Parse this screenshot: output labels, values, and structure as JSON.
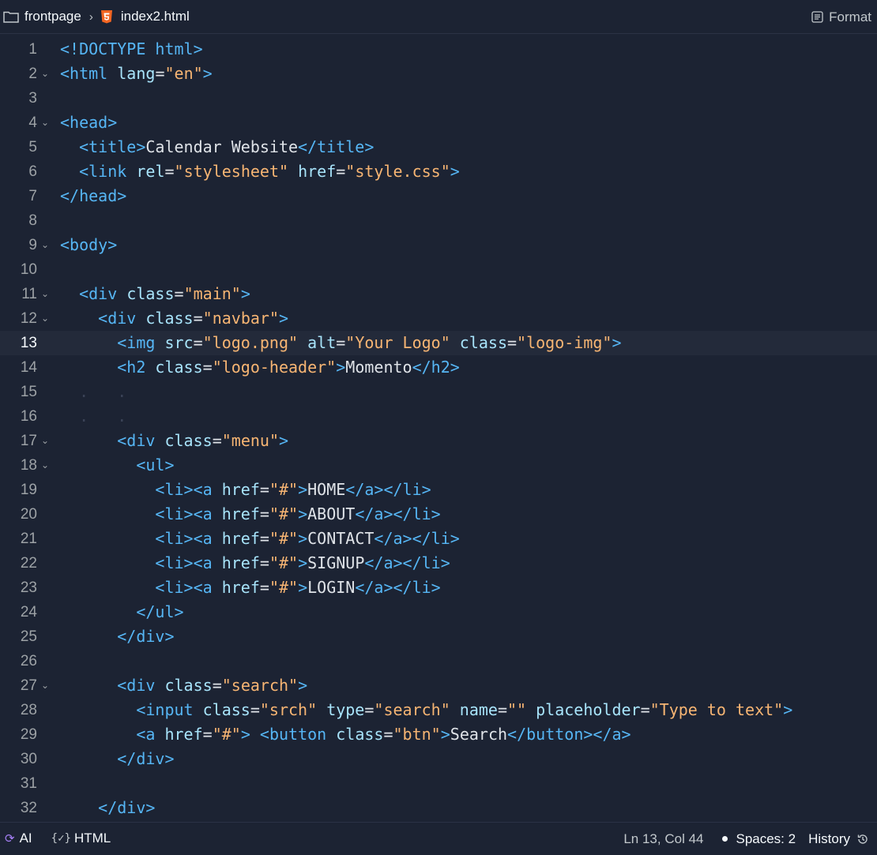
{
  "breadcrumb": {
    "folder": "frontpage",
    "file": "index2.html"
  },
  "toolbar": {
    "format_label": "Format"
  },
  "editor": {
    "active_line": 13,
    "lines": [
      {
        "n": "1",
        "fold": false,
        "code": [
          {
            "c": "t",
            "v": "<!DOCTYPE html>"
          }
        ]
      },
      {
        "n": "2",
        "fold": true,
        "code": [
          {
            "c": "t",
            "v": "<html"
          },
          {
            "c": "p",
            "v": " "
          },
          {
            "c": "a",
            "v": "lang"
          },
          {
            "c": "p",
            "v": "="
          },
          {
            "c": "s",
            "v": "\"en\""
          },
          {
            "c": "t",
            "v": ">"
          }
        ]
      },
      {
        "n": "3",
        "fold": false,
        "code": []
      },
      {
        "n": "4",
        "fold": true,
        "code": [
          {
            "c": "t",
            "v": "<head>"
          }
        ]
      },
      {
        "n": "5",
        "fold": false,
        "code": [
          {
            "c": "p",
            "v": "  "
          },
          {
            "c": "t",
            "v": "<title>"
          },
          {
            "c": "p",
            "v": "Calendar Website"
          },
          {
            "c": "t",
            "v": "</title>"
          }
        ]
      },
      {
        "n": "6",
        "fold": false,
        "code": [
          {
            "c": "p",
            "v": "  "
          },
          {
            "c": "t",
            "v": "<link"
          },
          {
            "c": "p",
            "v": " "
          },
          {
            "c": "a",
            "v": "rel"
          },
          {
            "c": "p",
            "v": "="
          },
          {
            "c": "s",
            "v": "\"stylesheet\""
          },
          {
            "c": "p",
            "v": " "
          },
          {
            "c": "a",
            "v": "href"
          },
          {
            "c": "p",
            "v": "="
          },
          {
            "c": "s",
            "v": "\"style.css\""
          },
          {
            "c": "t",
            "v": ">"
          }
        ]
      },
      {
        "n": "7",
        "fold": false,
        "code": [
          {
            "c": "t",
            "v": "</head>"
          }
        ]
      },
      {
        "n": "8",
        "fold": false,
        "code": []
      },
      {
        "n": "9",
        "fold": true,
        "code": [
          {
            "c": "t",
            "v": "<body>"
          }
        ]
      },
      {
        "n": "10",
        "fold": false,
        "code": []
      },
      {
        "n": "11",
        "fold": true,
        "code": [
          {
            "c": "p",
            "v": "  "
          },
          {
            "c": "t",
            "v": "<div"
          },
          {
            "c": "p",
            "v": " "
          },
          {
            "c": "a",
            "v": "class"
          },
          {
            "c": "p",
            "v": "="
          },
          {
            "c": "s",
            "v": "\"main\""
          },
          {
            "c": "t",
            "v": ">"
          }
        ]
      },
      {
        "n": "12",
        "fold": true,
        "code": [
          {
            "c": "p",
            "v": "    "
          },
          {
            "c": "t",
            "v": "<div"
          },
          {
            "c": "p",
            "v": " "
          },
          {
            "c": "a",
            "v": "class"
          },
          {
            "c": "p",
            "v": "="
          },
          {
            "c": "s",
            "v": "\"navbar\""
          },
          {
            "c": "t",
            "v": ">"
          }
        ]
      },
      {
        "n": "13",
        "fold": false,
        "code": [
          {
            "c": "p",
            "v": "      "
          },
          {
            "c": "t",
            "v": "<img"
          },
          {
            "c": "p",
            "v": " "
          },
          {
            "c": "a",
            "v": "src"
          },
          {
            "c": "p",
            "v": "="
          },
          {
            "c": "s",
            "v": "\"logo.png\""
          },
          {
            "c": "p",
            "v": " "
          },
          {
            "c": "a",
            "v": "alt"
          },
          {
            "c": "p",
            "v": "="
          },
          {
            "c": "s",
            "v": "\"Your Logo\""
          },
          {
            "c": "p",
            "v": " "
          },
          {
            "c": "a",
            "v": "class"
          },
          {
            "c": "p",
            "v": "="
          },
          {
            "c": "s",
            "v": "\"logo-img\""
          },
          {
            "c": "t",
            "v": ">"
          }
        ]
      },
      {
        "n": "14",
        "fold": false,
        "code": [
          {
            "c": "p",
            "v": "      "
          },
          {
            "c": "t",
            "v": "<h2"
          },
          {
            "c": "p",
            "v": " "
          },
          {
            "c": "a",
            "v": "class"
          },
          {
            "c": "p",
            "v": "="
          },
          {
            "c": "s",
            "v": "\"logo-header\""
          },
          {
            "c": "t",
            "v": ">"
          },
          {
            "c": "p",
            "v": "Momento"
          },
          {
            "c": "t",
            "v": "</h2>"
          }
        ]
      },
      {
        "n": "15",
        "fold": false,
        "code": [
          {
            "c": "g",
            "v": "  .   ."
          }
        ]
      },
      {
        "n": "16",
        "fold": false,
        "code": [
          {
            "c": "g",
            "v": "  .   ."
          }
        ]
      },
      {
        "n": "17",
        "fold": true,
        "code": [
          {
            "c": "p",
            "v": "      "
          },
          {
            "c": "t",
            "v": "<div"
          },
          {
            "c": "p",
            "v": " "
          },
          {
            "c": "a",
            "v": "class"
          },
          {
            "c": "p",
            "v": "="
          },
          {
            "c": "s",
            "v": "\"menu\""
          },
          {
            "c": "t",
            "v": ">"
          }
        ]
      },
      {
        "n": "18",
        "fold": true,
        "code": [
          {
            "c": "p",
            "v": "        "
          },
          {
            "c": "t",
            "v": "<ul>"
          }
        ]
      },
      {
        "n": "19",
        "fold": false,
        "code": [
          {
            "c": "p",
            "v": "          "
          },
          {
            "c": "t",
            "v": "<li><a"
          },
          {
            "c": "p",
            "v": " "
          },
          {
            "c": "a",
            "v": "href"
          },
          {
            "c": "p",
            "v": "="
          },
          {
            "c": "s",
            "v": "\"#\""
          },
          {
            "c": "t",
            "v": ">"
          },
          {
            "c": "p",
            "v": "HOME"
          },
          {
            "c": "t",
            "v": "</a></li>"
          }
        ]
      },
      {
        "n": "20",
        "fold": false,
        "code": [
          {
            "c": "p",
            "v": "          "
          },
          {
            "c": "t",
            "v": "<li><a"
          },
          {
            "c": "p",
            "v": " "
          },
          {
            "c": "a",
            "v": "href"
          },
          {
            "c": "p",
            "v": "="
          },
          {
            "c": "s",
            "v": "\"#\""
          },
          {
            "c": "t",
            "v": ">"
          },
          {
            "c": "p",
            "v": "ABOUT"
          },
          {
            "c": "t",
            "v": "</a></li>"
          }
        ]
      },
      {
        "n": "21",
        "fold": false,
        "code": [
          {
            "c": "p",
            "v": "          "
          },
          {
            "c": "t",
            "v": "<li><a"
          },
          {
            "c": "p",
            "v": " "
          },
          {
            "c": "a",
            "v": "href"
          },
          {
            "c": "p",
            "v": "="
          },
          {
            "c": "s",
            "v": "\"#\""
          },
          {
            "c": "t",
            "v": ">"
          },
          {
            "c": "p",
            "v": "CONTACT"
          },
          {
            "c": "t",
            "v": "</a></li>"
          }
        ]
      },
      {
        "n": "22",
        "fold": false,
        "code": [
          {
            "c": "p",
            "v": "          "
          },
          {
            "c": "t",
            "v": "<li><a"
          },
          {
            "c": "p",
            "v": " "
          },
          {
            "c": "a",
            "v": "href"
          },
          {
            "c": "p",
            "v": "="
          },
          {
            "c": "s",
            "v": "\"#\""
          },
          {
            "c": "t",
            "v": ">"
          },
          {
            "c": "p",
            "v": "SIGNUP"
          },
          {
            "c": "t",
            "v": "</a></li>"
          }
        ]
      },
      {
        "n": "23",
        "fold": false,
        "code": [
          {
            "c": "p",
            "v": "          "
          },
          {
            "c": "t",
            "v": "<li><a"
          },
          {
            "c": "p",
            "v": " "
          },
          {
            "c": "a",
            "v": "href"
          },
          {
            "c": "p",
            "v": "="
          },
          {
            "c": "s",
            "v": "\"#\""
          },
          {
            "c": "t",
            "v": ">"
          },
          {
            "c": "p",
            "v": "LOGIN"
          },
          {
            "c": "t",
            "v": "</a></li>"
          }
        ]
      },
      {
        "n": "24",
        "fold": false,
        "code": [
          {
            "c": "p",
            "v": "        "
          },
          {
            "c": "t",
            "v": "</ul>"
          }
        ]
      },
      {
        "n": "25",
        "fold": false,
        "code": [
          {
            "c": "p",
            "v": "      "
          },
          {
            "c": "t",
            "v": "</div>"
          }
        ]
      },
      {
        "n": "26",
        "fold": false,
        "code": []
      },
      {
        "n": "27",
        "fold": true,
        "code": [
          {
            "c": "p",
            "v": "      "
          },
          {
            "c": "t",
            "v": "<div"
          },
          {
            "c": "p",
            "v": " "
          },
          {
            "c": "a",
            "v": "class"
          },
          {
            "c": "p",
            "v": "="
          },
          {
            "c": "s",
            "v": "\"search\""
          },
          {
            "c": "t",
            "v": ">"
          }
        ]
      },
      {
        "n": "28",
        "fold": false,
        "code": [
          {
            "c": "p",
            "v": "        "
          },
          {
            "c": "t",
            "v": "<input"
          },
          {
            "c": "p",
            "v": " "
          },
          {
            "c": "a",
            "v": "class"
          },
          {
            "c": "p",
            "v": "="
          },
          {
            "c": "s",
            "v": "\"srch\""
          },
          {
            "c": "p",
            "v": " "
          },
          {
            "c": "a",
            "v": "type"
          },
          {
            "c": "p",
            "v": "="
          },
          {
            "c": "s",
            "v": "\"search\""
          },
          {
            "c": "p",
            "v": " "
          },
          {
            "c": "a",
            "v": "name"
          },
          {
            "c": "p",
            "v": "="
          },
          {
            "c": "s",
            "v": "\"\""
          },
          {
            "c": "p",
            "v": " "
          },
          {
            "c": "a",
            "v": "placeholder"
          },
          {
            "c": "p",
            "v": "="
          },
          {
            "c": "s",
            "v": "\"Type to text\""
          },
          {
            "c": "t",
            "v": ">"
          }
        ]
      },
      {
        "n": "29",
        "fold": false,
        "code": [
          {
            "c": "p",
            "v": "        "
          },
          {
            "c": "t",
            "v": "<a"
          },
          {
            "c": "p",
            "v": " "
          },
          {
            "c": "a",
            "v": "href"
          },
          {
            "c": "p",
            "v": "="
          },
          {
            "c": "s",
            "v": "\"#\""
          },
          {
            "c": "t",
            "v": ">"
          },
          {
            "c": "p",
            "v": " "
          },
          {
            "c": "t",
            "v": "<button"
          },
          {
            "c": "p",
            "v": " "
          },
          {
            "c": "a",
            "v": "class"
          },
          {
            "c": "p",
            "v": "="
          },
          {
            "c": "s",
            "v": "\"btn\""
          },
          {
            "c": "t",
            "v": ">"
          },
          {
            "c": "p",
            "v": "Search"
          },
          {
            "c": "t",
            "v": "</button></a>"
          }
        ]
      },
      {
        "n": "30",
        "fold": false,
        "code": [
          {
            "c": "p",
            "v": "      "
          },
          {
            "c": "t",
            "v": "</div>"
          }
        ]
      },
      {
        "n": "31",
        "fold": false,
        "code": []
      },
      {
        "n": "32",
        "fold": false,
        "code": [
          {
            "c": "p",
            "v": "    "
          },
          {
            "c": "t",
            "v": "</div>"
          }
        ]
      }
    ]
  },
  "statusbar": {
    "ai_label": "AI",
    "lang_icon": "{✓}",
    "language": "HTML",
    "cursor_pos": "Ln 13, Col 44",
    "spaces": "Spaces: 2",
    "history": "History"
  },
  "colors": {
    "background": "#1c2333",
    "tag": "#56b6f5",
    "attribute": "#a8e4fb",
    "string": "#f7b573",
    "text": "#f5f9fc",
    "ai_accent": "#a57ff5",
    "html_icon": "#f26522"
  },
  "icons": [
    "folder-icon",
    "chevron-right-icon",
    "html5-icon",
    "format-icon",
    "fold-chevron-icon",
    "ai-icon",
    "code-check-icon",
    "history-icon"
  ]
}
